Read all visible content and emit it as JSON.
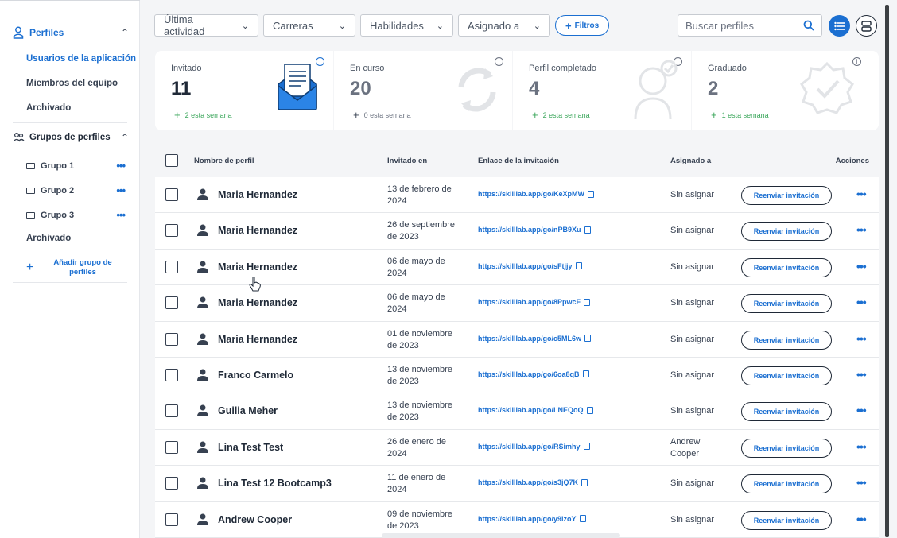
{
  "sidebar": {
    "profiles_label": "Perfiles",
    "items": [
      {
        "label": "Usuarios de la aplicación",
        "active": true
      },
      {
        "label": "Miembros del equipo"
      },
      {
        "label": "Archivado"
      }
    ],
    "groups_label": "Grupos de perfiles",
    "groups": [
      {
        "label": "Grupo 1"
      },
      {
        "label": "Grupo 2"
      },
      {
        "label": "Grupo 3"
      }
    ],
    "groups_archived": "Archivado",
    "add_group": "Añadir grupo de perfiles"
  },
  "filters": {
    "last_activity": "Última actividad",
    "careers": "Carreras",
    "skills": "Habilidades",
    "assigned": "Asignado a",
    "filters_btn": "Filtros",
    "search_placeholder": "Buscar perfiles"
  },
  "stats": [
    {
      "title": "Invitado",
      "value": "11",
      "week": "2 esta semana",
      "icon": "envelope-icon"
    },
    {
      "title": "En curso",
      "value": "20",
      "week": "0 esta semana",
      "icon": "refresh-icon"
    },
    {
      "title": "Perfil completado",
      "value": "4",
      "week": "2 esta semana",
      "icon": "person-check-icon"
    },
    {
      "title": "Graduado",
      "value": "2",
      "week": "1 esta semana",
      "icon": "badge-check-icon"
    }
  ],
  "table": {
    "headers": {
      "name": "Nombre de perfil",
      "invited": "Invitado en",
      "link": "Enlace de la invitación",
      "assigned": "Asignado a",
      "actions": "Acciones"
    },
    "resend_label": "Reenviar invitación",
    "rows": [
      {
        "name": "Maria Hernandez",
        "invited": "13 de febrero de 2024",
        "link": "https://skilllab.app/go/KeXpMW",
        "assigned": "Sin asignar"
      },
      {
        "name": "Maria Hernandez",
        "invited": "26 de septiembre de 2023",
        "link": "https://skilllab.app/go/nPB9Xu",
        "assigned": "Sin asignar"
      },
      {
        "name": "Maria Hernandez",
        "invited": "06 de mayo de 2024",
        "link": "https://skilllab.app/go/sFtjjy",
        "assigned": "Sin asignar"
      },
      {
        "name": "Maria Hernandez",
        "invited": "06 de mayo de 2024",
        "link": "https://skilllab.app/go/8PpwcF",
        "assigned": "Sin asignar"
      },
      {
        "name": "Maria Hernandez",
        "invited": "01 de noviembre de 2023",
        "link": "https://skilllab.app/go/c5ML6w",
        "assigned": "Sin asignar"
      },
      {
        "name": "Franco Carmelo",
        "invited": "13 de noviembre de 2023",
        "link": "https://skilllab.app/go/6oa8qB",
        "assigned": "Sin asignar"
      },
      {
        "name": "Guilia Meher",
        "invited": "13 de noviembre de 2023",
        "link": "https://skilllab.app/go/LNEQoQ",
        "assigned": "Sin asignar"
      },
      {
        "name": "Lina Test Test",
        "invited": "26 de enero de 2024",
        "link": "https://skilllab.app/go/RSimhy",
        "assigned": "Andrew Cooper"
      },
      {
        "name": "Lina Test 12 Bootcamp3",
        "invited": "11 de enero de 2024",
        "link": "https://skilllab.app/go/s3jQ7K",
        "assigned": "Sin asignar"
      },
      {
        "name": "Andrew Cooper",
        "invited": "09 de noviembre de 2023",
        "link": "https://skilllab.app/go/y9izoY",
        "assigned": "Sin asignar"
      }
    ]
  },
  "colors": {
    "accent": "#1b6fd1",
    "positive": "#3aa65a"
  }
}
